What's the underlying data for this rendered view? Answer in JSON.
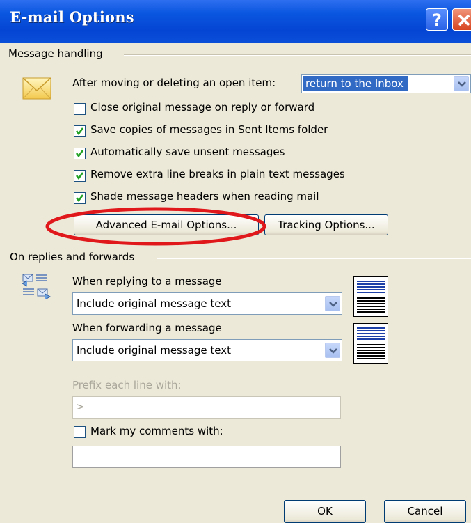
{
  "dialog": {
    "title": "E-mail Options",
    "help_label": "?"
  },
  "message_handling": {
    "group_label": "Message handling",
    "after_move_label": "After moving or deleting an open item:",
    "after_move_value": "return to the Inbox",
    "checkboxes": [
      {
        "label": "Close original message on reply or forward",
        "checked": false
      },
      {
        "label": "Save copies of messages in Sent Items folder",
        "checked": true
      },
      {
        "label": "Automatically save unsent messages",
        "checked": true
      },
      {
        "label": "Remove extra line breaks in plain text messages",
        "checked": true
      },
      {
        "label": "Shade message headers when reading mail",
        "checked": true
      }
    ],
    "advanced_button": "Advanced E-mail Options...",
    "tracking_button": "Tracking Options..."
  },
  "replies": {
    "group_label": "On replies and forwards",
    "replying_label": "When replying to a message",
    "replying_value": "Include original message text",
    "forwarding_label": "When forwarding a message",
    "forwarding_value": "Include original message text",
    "prefix_label": "Prefix each line with:",
    "prefix_value": ">",
    "mark_comments_label": "Mark my comments with:",
    "mark_comments_checked": false,
    "mark_comments_value": ""
  },
  "footer": {
    "ok_label": "OK",
    "cancel_label": "Cancel"
  },
  "colors": {
    "titlebar": "#0a57e0",
    "highlight_ellipse": "#e0181c",
    "selection": "#316ac5"
  }
}
